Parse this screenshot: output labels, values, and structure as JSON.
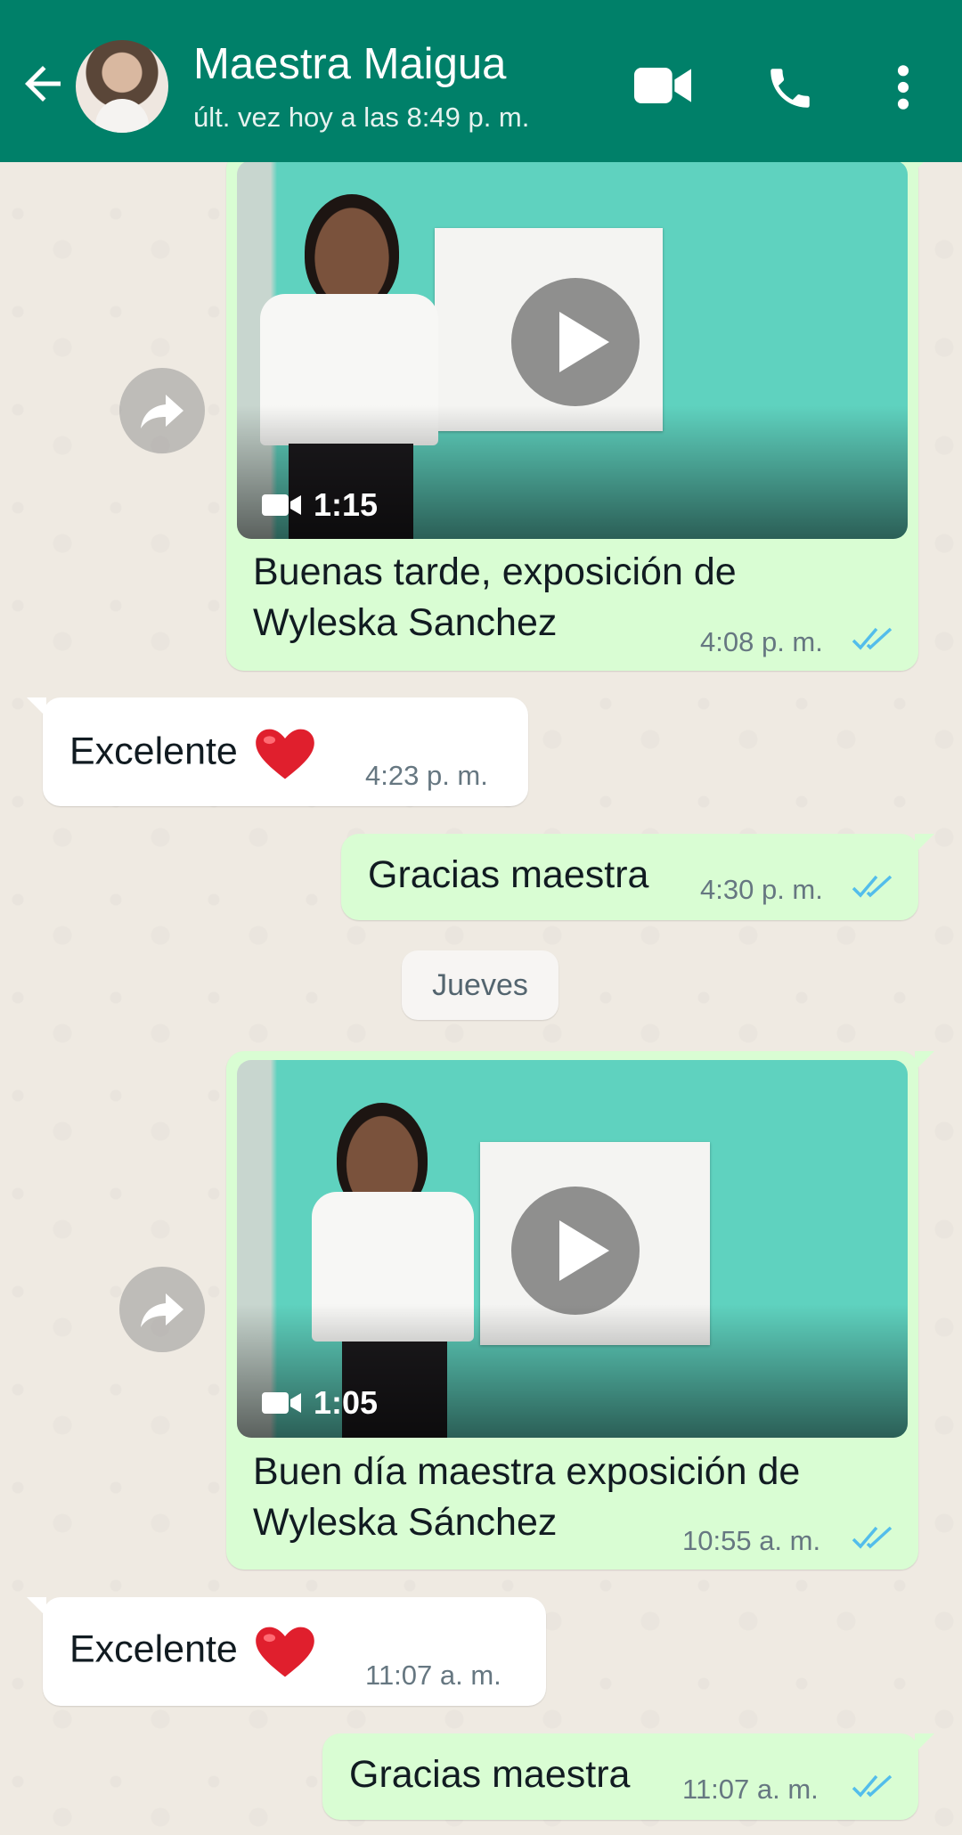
{
  "header": {
    "contact_name": "Maestra Maigua",
    "last_seen": "últ. vez hoy a las 8:49 p. m.",
    "back_icon": "arrow-left-icon",
    "video_call_icon": "video-camera-icon",
    "voice_call_icon": "phone-icon",
    "menu_icon": "more-vertical-icon",
    "color": "#008069"
  },
  "messages": [
    {
      "direction": "outgoing",
      "type": "video",
      "duration": "1:15",
      "caption_line1": "Buenas tarde, exposición de",
      "caption_line2": "Wyleska Sanchez",
      "time": "4:08 p. m.",
      "status": "read"
    },
    {
      "direction": "incoming",
      "type": "text",
      "text": "Excelente",
      "emoji": "red-heart",
      "time": "4:23 p. m."
    },
    {
      "direction": "outgoing",
      "type": "text",
      "text": "Gracias maestra",
      "time": "4:30 p. m.",
      "status": "read"
    },
    {
      "direction": "outgoing",
      "type": "video",
      "duration": "1:05",
      "caption_line1": "Buen día maestra exposición de",
      "caption_line2": "Wyleska Sánchez",
      "time": "10:55 a. m.",
      "status": "read"
    },
    {
      "direction": "incoming",
      "type": "text",
      "text": "Excelente",
      "emoji": "red-heart",
      "time": "11:07 a. m."
    },
    {
      "direction": "outgoing",
      "type": "text",
      "text": "Gracias maestra",
      "time": "11:07 a. m.",
      "status": "read"
    }
  ],
  "date_separator": "Jueves",
  "colors": {
    "outgoing_bubble": "#d9fdd3",
    "incoming_bubble": "#ffffff",
    "read_ticks": "#53bdeb",
    "chat_background": "#efeae2"
  }
}
